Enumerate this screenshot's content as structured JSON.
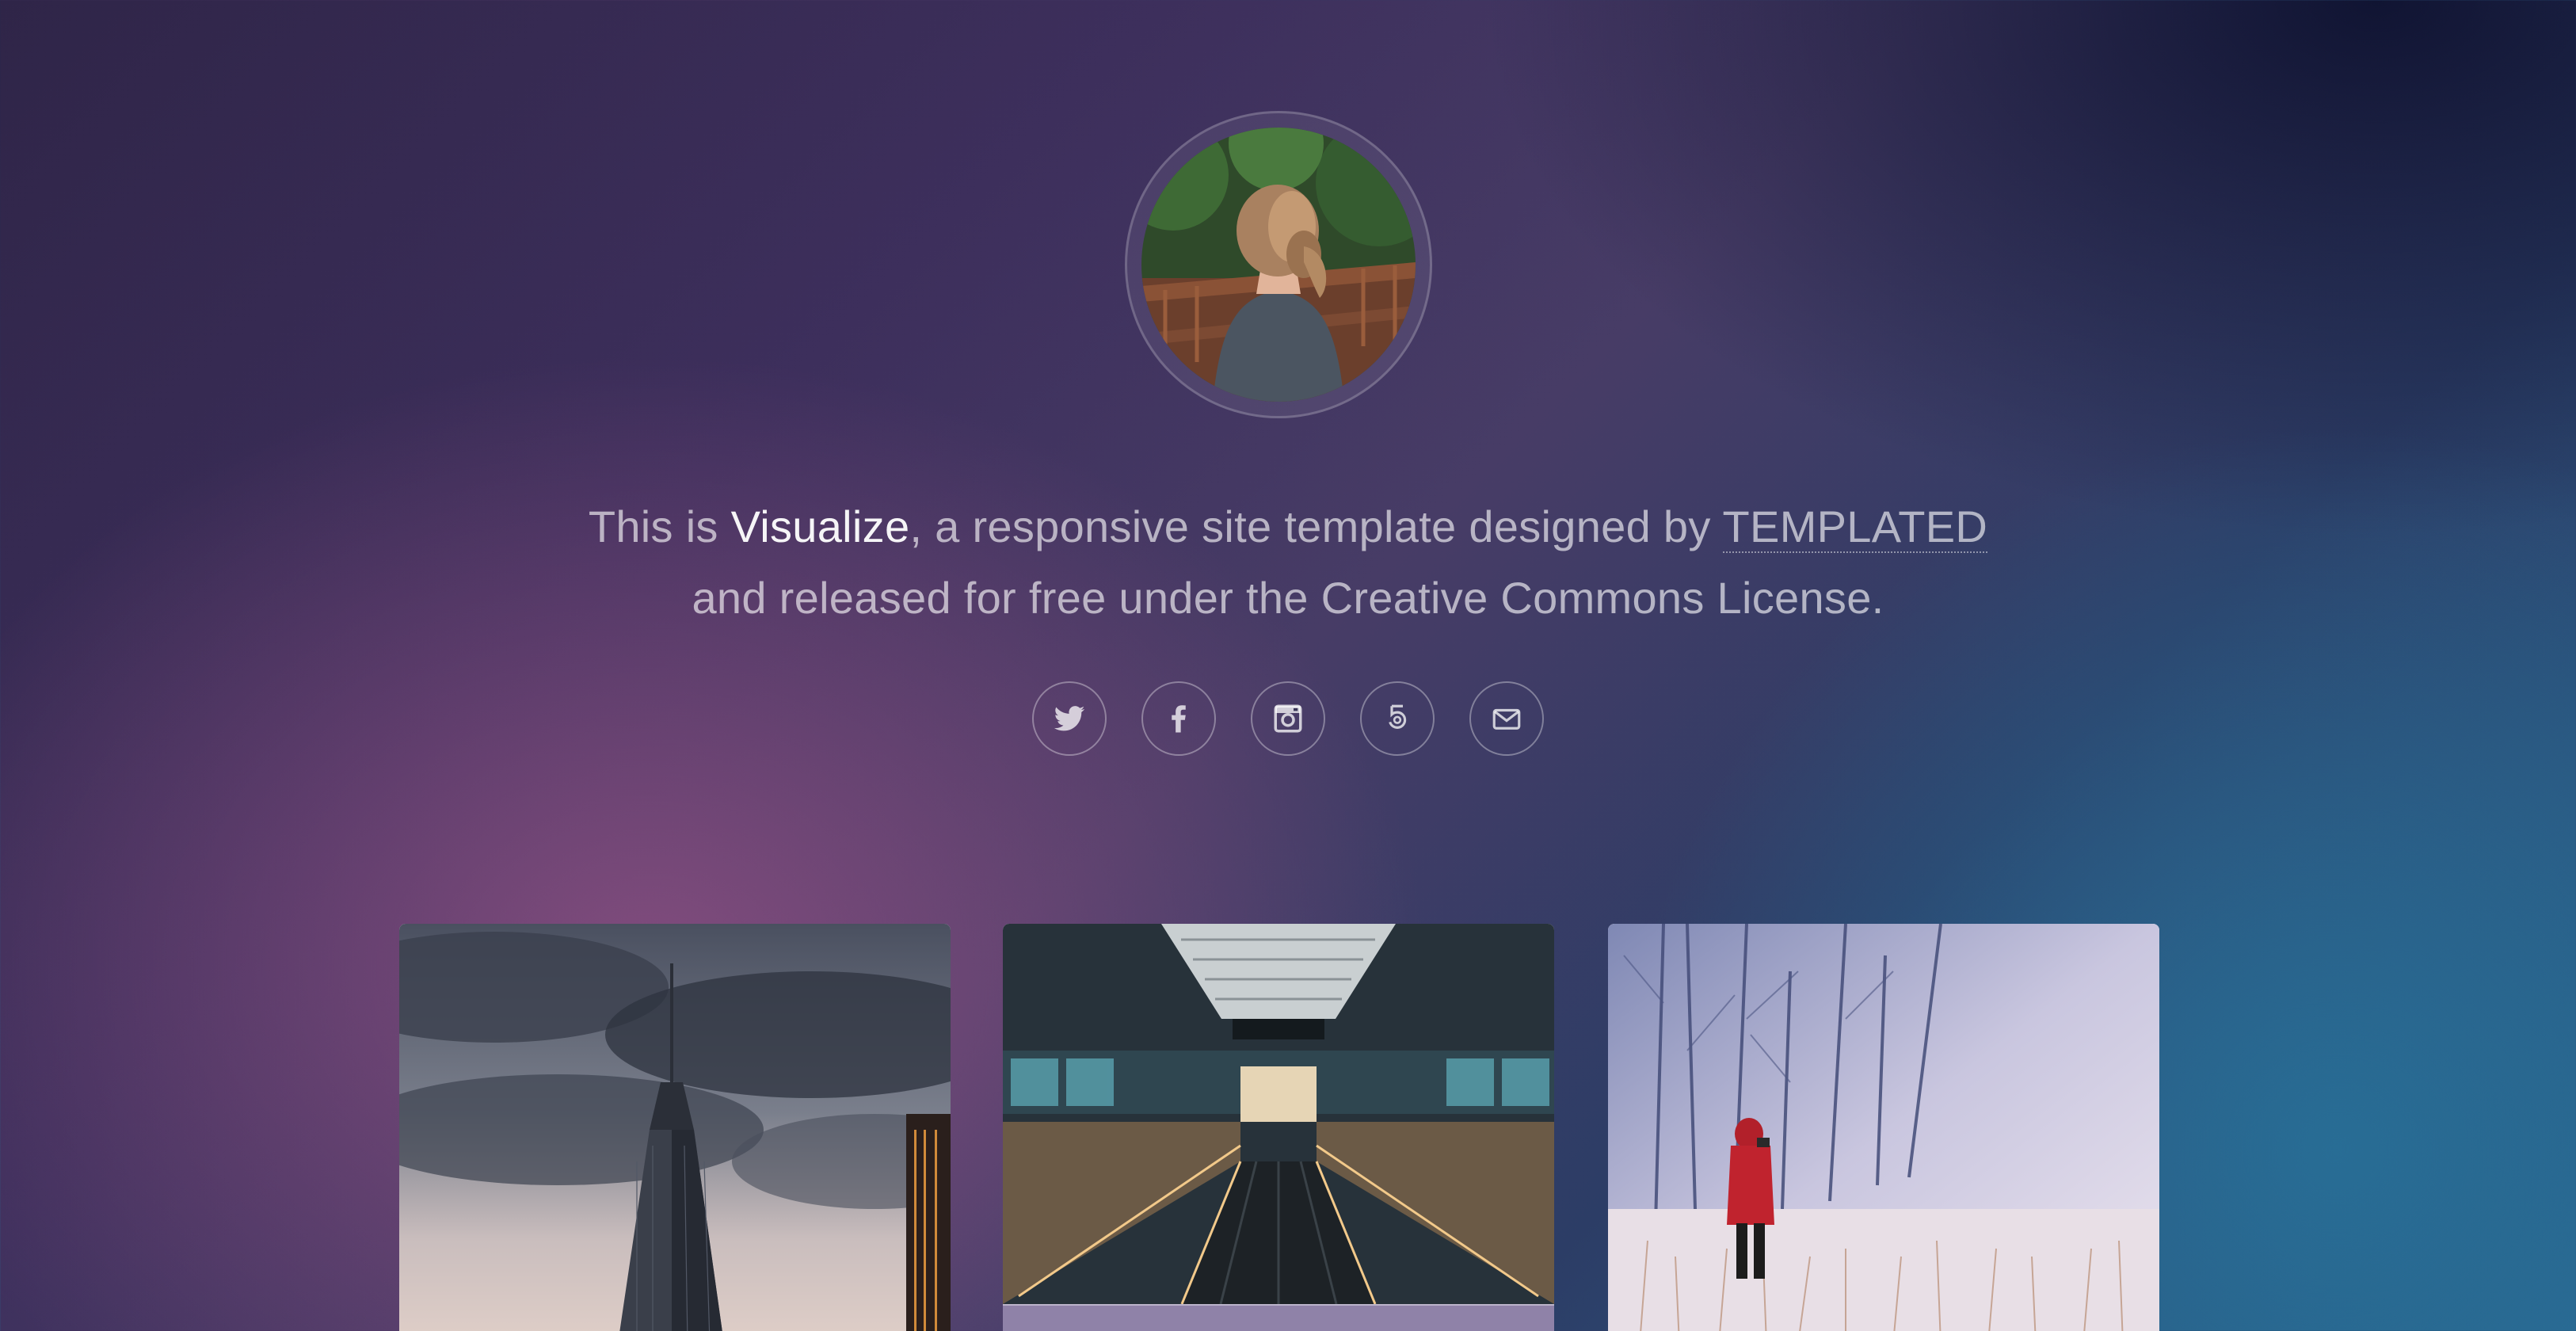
{
  "intro": {
    "prefix": "This is ",
    "brand": "Visualize",
    "middle": ", a responsive site template designed by ",
    "link_text": "TEMPLATED",
    "line2": "and released for free under the Creative Commons License."
  },
  "social": [
    {
      "icon": "twitter-icon"
    },
    {
      "icon": "facebook-icon"
    },
    {
      "icon": "instagram-icon"
    },
    {
      "icon": "500px-icon"
    },
    {
      "icon": "envelope-icon"
    }
  ],
  "gallery": [
    {
      "subject": "skyscraper"
    },
    {
      "subject": "escalator"
    },
    {
      "subject": "person-in-snow"
    }
  ],
  "colors": {
    "text": "#ffffffb0",
    "accent": "#ffffff"
  }
}
